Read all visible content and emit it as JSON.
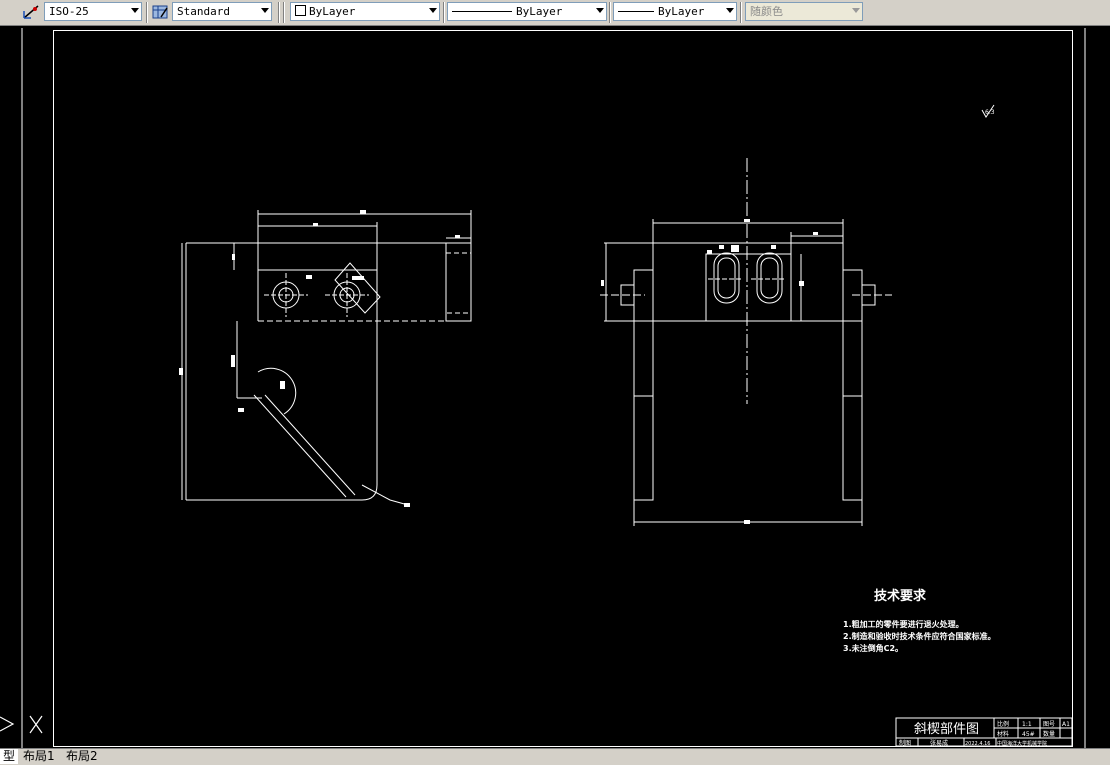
{
  "toolbar": {
    "dimstyle": "ISO-25",
    "tablestyle": "Standard",
    "color": "ByLayer",
    "linetype": "ByLayer",
    "lineweight": "ByLayer",
    "plotstyle": "随颜色"
  },
  "drawing": {
    "tech_title": "技术要求",
    "tech_line1": "1.粗加工的零件要进行退火处理。",
    "tech_line2": "2.制造和验收时技术条件应符合国家标准。",
    "tech_line3": "3.未注倒角C2。",
    "title_name": "斜楔部件图",
    "tb_scale_label": "比例",
    "tb_scale": "1:1",
    "tb_no_label": "图号",
    "tb_size": "A1",
    "tb_material_label": "材料",
    "tb_material": "45#",
    "tb_qty_label": "数量",
    "tb_draw_label": "制图",
    "tb_drawer": "张易成",
    "tb_date": "2022.4.16",
    "tb_school": "中国海洋大学机械学院"
  },
  "tabs": {
    "model": "型",
    "layout1": "布局1",
    "layout2": "布局2"
  }
}
